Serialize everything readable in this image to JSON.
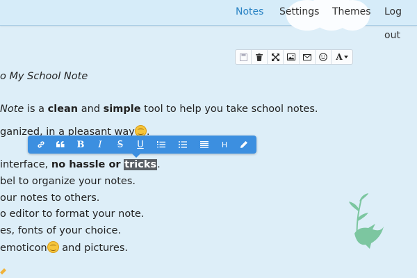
{
  "nav": {
    "items": [
      {
        "label": "Notes",
        "active": true
      },
      {
        "label": "Settings",
        "active": false
      },
      {
        "label": "Themes",
        "active": false
      },
      {
        "label": "Log out",
        "active": false
      }
    ]
  },
  "editor_toolbar": {
    "icons": [
      "save-icon",
      "delete-icon",
      "fullscreen-icon",
      "image-icon",
      "mail-icon",
      "emoticon-icon",
      "font-icon",
      "caret-down-icon"
    ],
    "font_label": "A"
  },
  "format_bar": {
    "items": [
      "link",
      "quote",
      "B",
      "I",
      "S",
      "U",
      "numbered-list",
      "bullet-list",
      "align",
      "H",
      "pencil"
    ],
    "bold_label": "B",
    "italic_label": "I",
    "strike_label": "S",
    "underline_label": "U",
    "heading_label": "H"
  },
  "note": {
    "title": "o My School Note",
    "line1": {
      "a": "Note",
      "b": " is a ",
      "c": "clean",
      "d": " and ",
      "e": "simple",
      "f": " tool to help you take school notes."
    },
    "line2": "ganized, in a pleasant way",
    "line2_end": ".",
    "line3": {
      "a": "interface, ",
      "b": "no hassle or",
      "c": " ",
      "d": "tricks",
      "e": "."
    },
    "line4": "bel to organize your notes.",
    "line5": "our notes to others.",
    "line6": "o editor to format your note.",
    "line7": "es, fonts of your choice.",
    "line8": {
      "a": "emoticon",
      "b": " and pictures."
    }
  },
  "colors": {
    "background": "#ddeef8",
    "nav_active": "#2a83c4",
    "format_bar": "#3c8fe0",
    "highlight": "#5b6066",
    "bird": "#7cc6a0"
  }
}
